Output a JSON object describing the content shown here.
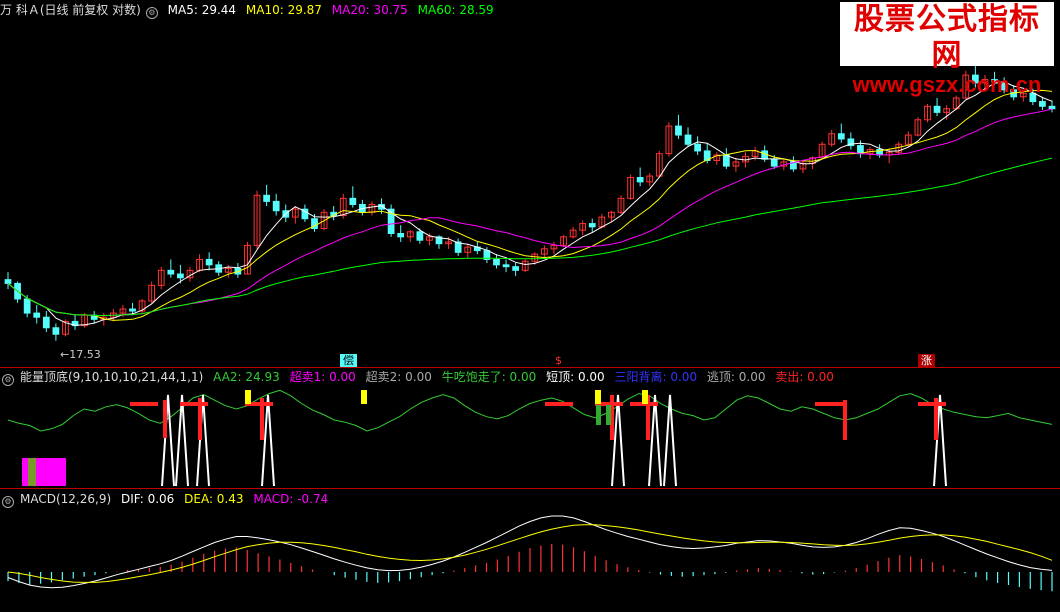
{
  "header": {
    "stock_title": "万 科Ａ(日线 前复权 对数)",
    "ma5": "MA5: 29.44",
    "ma10": "MA10: 29.87",
    "ma20": "MA20: 30.75",
    "ma60": "MA60: 28.59"
  },
  "watermark": {
    "line1": "股票公式指标网",
    "line2": "www.gszx.com.cn"
  },
  "price_panel": {
    "low_label": "17.53",
    "tag1": "偿",
    "tag2": "$",
    "tag3": "涨"
  },
  "indicator_panel": {
    "name": "能量顶底(9,10,10,10,21,44,1,1)",
    "aa2": "AA2: 24.93",
    "chaomai1": "超卖1: 0.00",
    "chaomai2": "超卖2: 0.00",
    "niuchi": "牛吃饱走了: 0.00",
    "duanding": "短顶: 0.00",
    "sanyang": "三阳背离: 0.00",
    "taoding": "逃顶: 0.00",
    "maichu": "卖出: 0.00"
  },
  "macd_panel": {
    "name": "MACD(12,26,9)",
    "dif": "DIF: 0.06",
    "dea": "DEA: 0.43",
    "macd": "MACD: -0.74"
  },
  "colors": {
    "up": "#ff3333",
    "down": "#54fcfc",
    "ma5": "#ffffff",
    "ma10": "#ffff00",
    "ma20": "#ff00ff",
    "ma60": "#00ff00",
    "aa2": "#33cc33",
    "signal_white": "#ffffff",
    "signal_yellow": "#ffff00",
    "signal_red": "#ff2222",
    "dif": "#ffffff",
    "dea": "#ffff00",
    "macd_pos": "#ff3333",
    "macd_neg": "#54fcfc",
    "text_magenta": "#ff00ff"
  },
  "chart_data": {
    "type": "candlestick",
    "scale": "log",
    "ylim": [
      17.0,
      36.0
    ],
    "low_marker": 17.53,
    "last": {
      "ma5": 29.44,
      "ma10": 29.87,
      "ma20": 30.75,
      "ma60": 28.59
    },
    "ohlc": [
      [
        20.5,
        20.9,
        20.0,
        20.3
      ],
      [
        20.3,
        20.4,
        19.3,
        19.5
      ],
      [
        19.5,
        19.7,
        18.6,
        18.8
      ],
      [
        18.8,
        19.2,
        18.3,
        18.6
      ],
      [
        18.6,
        18.9,
        17.9,
        18.1
      ],
      [
        18.1,
        18.3,
        17.5,
        17.8
      ],
      [
        17.8,
        18.5,
        17.7,
        18.4
      ],
      [
        18.4,
        18.7,
        18.0,
        18.2
      ],
      [
        18.2,
        18.8,
        18.1,
        18.7
      ],
      [
        18.7,
        18.9,
        18.3,
        18.5
      ],
      [
        18.5,
        18.8,
        18.2,
        18.6
      ],
      [
        18.6,
        19.0,
        18.4,
        18.8
      ],
      [
        18.8,
        19.2,
        18.6,
        19.0
      ],
      [
        19.0,
        19.3,
        18.7,
        18.9
      ],
      [
        18.9,
        19.5,
        18.8,
        19.4
      ],
      [
        19.4,
        20.4,
        19.3,
        20.2
      ],
      [
        20.2,
        21.2,
        20.0,
        21.0
      ],
      [
        21.0,
        21.6,
        20.6,
        20.8
      ],
      [
        20.8,
        21.3,
        20.3,
        20.6
      ],
      [
        20.6,
        21.2,
        20.4,
        21.0
      ],
      [
        21.0,
        21.9,
        20.9,
        21.6
      ],
      [
        21.6,
        22.0,
        21.0,
        21.3
      ],
      [
        21.3,
        21.5,
        20.7,
        20.9
      ],
      [
        20.9,
        21.3,
        20.6,
        21.1
      ],
      [
        21.1,
        21.4,
        20.6,
        20.8
      ],
      [
        20.8,
        22.6,
        20.8,
        22.4
      ],
      [
        22.4,
        25.8,
        22.2,
        25.5
      ],
      [
        25.5,
        26.2,
        24.8,
        25.1
      ],
      [
        25.1,
        25.6,
        24.2,
        24.5
      ],
      [
        24.5,
        24.9,
        23.8,
        24.1
      ],
      [
        24.1,
        24.8,
        23.7,
        24.6
      ],
      [
        24.6,
        24.9,
        23.8,
        24.0
      ],
      [
        24.0,
        24.3,
        23.2,
        23.4
      ],
      [
        23.4,
        24.6,
        23.3,
        24.4
      ],
      [
        24.4,
        24.8,
        23.9,
        24.2
      ],
      [
        24.2,
        25.6,
        24.0,
        25.3
      ],
      [
        25.3,
        26.1,
        24.7,
        24.9
      ],
      [
        24.9,
        25.2,
        24.2,
        24.4
      ],
      [
        24.4,
        25.1,
        24.2,
        24.9
      ],
      [
        24.9,
        25.3,
        24.3,
        24.6
      ],
      [
        24.6,
        24.9,
        22.9,
        23.1
      ],
      [
        23.1,
        23.6,
        22.6,
        22.9
      ],
      [
        22.9,
        23.3,
        22.6,
        23.2
      ],
      [
        23.2,
        23.4,
        22.5,
        22.7
      ],
      [
        22.7,
        23.1,
        22.4,
        22.9
      ],
      [
        22.9,
        23.0,
        22.2,
        22.5
      ],
      [
        22.5,
        22.9,
        22.2,
        22.6
      ],
      [
        22.6,
        22.8,
        21.8,
        22.0
      ],
      [
        22.0,
        22.5,
        21.7,
        22.3
      ],
      [
        22.3,
        22.6,
        21.9,
        22.1
      ],
      [
        22.1,
        22.3,
        21.4,
        21.6
      ],
      [
        21.6,
        21.9,
        21.1,
        21.3
      ],
      [
        21.3,
        21.6,
        20.9,
        21.2
      ],
      [
        21.2,
        21.4,
        20.7,
        21.0
      ],
      [
        21.0,
        21.6,
        20.9,
        21.5
      ],
      [
        21.5,
        22.0,
        21.3,
        21.9
      ],
      [
        21.9,
        22.4,
        21.7,
        22.2
      ],
      [
        22.2,
        22.6,
        21.9,
        22.4
      ],
      [
        22.4,
        23.0,
        22.3,
        22.9
      ],
      [
        22.9,
        23.5,
        22.8,
        23.3
      ],
      [
        23.3,
        23.9,
        23.0,
        23.7
      ],
      [
        23.7,
        24.0,
        23.2,
        23.5
      ],
      [
        23.5,
        24.3,
        23.4,
        24.1
      ],
      [
        24.1,
        24.5,
        23.8,
        24.4
      ],
      [
        24.4,
        25.5,
        24.3,
        25.3
      ],
      [
        25.3,
        26.9,
        25.2,
        26.7
      ],
      [
        26.7,
        27.4,
        26.1,
        26.4
      ],
      [
        26.4,
        27.0,
        26.1,
        26.8
      ],
      [
        26.8,
        28.6,
        26.7,
        28.4
      ],
      [
        28.4,
        30.8,
        28.2,
        30.5
      ],
      [
        30.5,
        31.4,
        29.5,
        29.8
      ],
      [
        29.8,
        30.4,
        28.9,
        29.1
      ],
      [
        29.1,
        29.7,
        28.3,
        28.6
      ],
      [
        28.6,
        29.2,
        27.7,
        27.9
      ],
      [
        27.9,
        28.5,
        27.6,
        28.3
      ],
      [
        28.3,
        28.8,
        27.3,
        27.5
      ],
      [
        27.5,
        28.1,
        27.1,
        27.8
      ],
      [
        27.8,
        28.5,
        27.4,
        28.2
      ],
      [
        28.2,
        28.9,
        27.9,
        28.6
      ],
      [
        28.6,
        29.0,
        27.8,
        28.0
      ],
      [
        28.0,
        28.3,
        27.3,
        27.5
      ],
      [
        27.5,
        28.0,
        27.2,
        27.8
      ],
      [
        27.8,
        28.2,
        27.1,
        27.3
      ],
      [
        27.3,
        27.9,
        27.0,
        27.7
      ],
      [
        27.7,
        28.2,
        27.3,
        28.1
      ],
      [
        28.1,
        29.3,
        28.0,
        29.1
      ],
      [
        29.1,
        30.2,
        28.9,
        29.9
      ],
      [
        29.9,
        30.7,
        29.2,
        29.5
      ],
      [
        29.5,
        30.0,
        28.7,
        29.0
      ],
      [
        29.0,
        29.4,
        28.1,
        28.4
      ],
      [
        28.4,
        28.9,
        28.0,
        28.7
      ],
      [
        28.7,
        29.1,
        28.1,
        28.3
      ],
      [
        28.3,
        28.8,
        27.7,
        28.5
      ],
      [
        28.5,
        29.3,
        28.3,
        29.1
      ],
      [
        29.1,
        30.1,
        28.9,
        29.8
      ],
      [
        29.8,
        31.2,
        29.7,
        31.0
      ],
      [
        31.0,
        32.3,
        30.8,
        32.1
      ],
      [
        32.1,
        32.8,
        31.3,
        31.6
      ],
      [
        31.6,
        32.2,
        31.0,
        31.9
      ],
      [
        31.9,
        33.0,
        31.8,
        32.8
      ],
      [
        32.8,
        35.2,
        32.7,
        34.8
      ],
      [
        34.8,
        35.7,
        33.7,
        34.1
      ],
      [
        34.1,
        34.8,
        33.6,
        34.4
      ],
      [
        34.4,
        35.1,
        33.9,
        34.2
      ],
      [
        34.2,
        34.6,
        33.2,
        33.5
      ],
      [
        33.5,
        33.9,
        32.6,
        32.9
      ],
      [
        32.9,
        33.5,
        32.5,
        33.2
      ],
      [
        33.2,
        33.6,
        32.2,
        32.5
      ],
      [
        32.5,
        32.9,
        31.8,
        32.1
      ],
      [
        32.1,
        32.6,
        31.6,
        31.9
      ]
    ],
    "aa2": [
      60,
      57,
      55,
      50,
      52,
      56,
      64,
      70,
      68,
      72,
      74,
      71,
      66,
      60,
      57,
      63,
      71,
      80,
      83,
      78,
      73,
      70,
      73,
      79,
      84,
      87,
      82,
      75,
      69,
      65,
      60,
      58,
      55,
      50,
      53,
      58,
      63,
      70,
      76,
      80,
      83,
      80,
      73,
      67,
      63,
      61,
      64,
      70,
      75,
      78,
      80,
      77,
      71,
      65,
      62,
      66,
      72,
      79,
      84,
      82,
      75,
      70,
      66,
      64,
      60,
      62,
      70,
      78,
      82,
      80,
      75,
      70,
      68,
      72,
      70,
      66,
      62,
      60,
      62,
      66,
      70,
      76,
      82,
      84,
      80,
      74,
      70,
      67,
      65,
      63,
      62,
      64,
      66,
      62,
      60,
      58,
      56
    ],
    "macd_hist": [
      -0.35,
      -0.42,
      -0.5,
      -0.45,
      -0.4,
      -0.32,
      -0.25,
      -0.18,
      -0.12,
      -0.05,
      0.02,
      0.08,
      0.12,
      0.16,
      0.2,
      0.28,
      0.4,
      0.55,
      0.7,
      0.82,
      0.9,
      0.95,
      0.85,
      0.72,
      0.6,
      0.48,
      0.35,
      0.22,
      0.1,
      0.0,
      -0.12,
      -0.22,
      -0.3,
      -0.38,
      -0.42,
      -0.4,
      -0.35,
      -0.28,
      -0.2,
      -0.12,
      -0.05,
      0.05,
      0.15,
      0.25,
      0.35,
      0.48,
      0.62,
      0.78,
      0.92,
      1.02,
      1.08,
      1.05,
      0.95,
      0.8,
      0.62,
      0.45,
      0.3,
      0.18,
      0.08,
      -0.02,
      -0.1,
      -0.15,
      -0.18,
      -0.16,
      -0.12,
      -0.08,
      -0.03,
      0.05,
      0.1,
      0.15,
      0.12,
      0.08,
      0.02,
      -0.05,
      -0.1,
      -0.08,
      -0.02,
      0.05,
      0.15,
      0.28,
      0.42,
      0.55,
      0.65,
      0.6,
      0.5,
      0.38,
      0.25,
      0.1,
      -0.05,
      -0.2,
      -0.32,
      -0.42,
      -0.5,
      -0.58,
      -0.65,
      -0.7,
      -0.74
    ],
    "dif": [
      -0.2,
      -0.35,
      -0.48,
      -0.55,
      -0.58,
      -0.56,
      -0.5,
      -0.42,
      -0.33,
      -0.22,
      -0.1,
      0.0,
      0.1,
      0.2,
      0.3,
      0.42,
      0.58,
      0.75,
      0.92,
      1.08,
      1.2,
      1.3,
      1.3,
      1.25,
      1.18,
      1.1,
      1.0,
      0.88,
      0.75,
      0.62,
      0.48,
      0.36,
      0.25,
      0.15,
      0.08,
      0.05,
      0.06,
      0.1,
      0.18,
      0.28,
      0.4,
      0.55,
      0.72,
      0.9,
      1.08,
      1.28,
      1.48,
      1.68,
      1.85,
      1.98,
      2.05,
      2.05,
      1.98,
      1.85,
      1.7,
      1.55,
      1.42,
      1.3,
      1.2,
      1.1,
      1.0,
      0.93,
      0.88,
      0.86,
      0.88,
      0.92,
      0.97,
      1.05,
      1.1,
      1.15,
      1.14,
      1.1,
      1.05,
      0.98,
      0.92,
      0.9,
      0.92,
      0.98,
      1.08,
      1.22,
      1.38,
      1.52,
      1.62,
      1.6,
      1.52,
      1.42,
      1.3,
      1.15,
      0.98,
      0.82,
      0.66,
      0.52,
      0.38,
      0.26,
      0.16,
      0.1,
      0.06
    ],
    "dea": [
      0.0,
      -0.05,
      -0.12,
      -0.2,
      -0.27,
      -0.33,
      -0.37,
      -0.38,
      -0.38,
      -0.35,
      -0.3,
      -0.24,
      -0.17,
      -0.1,
      -0.02,
      0.07,
      0.17,
      0.29,
      0.42,
      0.56,
      0.69,
      0.82,
      0.93,
      1.0,
      1.06,
      1.09,
      1.09,
      1.07,
      1.03,
      0.97,
      0.9,
      0.82,
      0.74,
      0.65,
      0.57,
      0.51,
      0.46,
      0.43,
      0.42,
      0.44,
      0.48,
      0.54,
      0.62,
      0.72,
      0.83,
      0.96,
      1.09,
      1.22,
      1.35,
      1.47,
      1.57,
      1.65,
      1.71,
      1.73,
      1.73,
      1.7,
      1.66,
      1.6,
      1.54,
      1.46,
      1.39,
      1.32,
      1.25,
      1.19,
      1.14,
      1.1,
      1.08,
      1.07,
      1.07,
      1.08,
      1.09,
      1.09,
      1.08,
      1.06,
      1.03,
      1.0,
      0.98,
      0.97,
      0.99,
      1.03,
      1.09,
      1.16,
      1.24,
      1.3,
      1.34,
      1.36,
      1.36,
      1.33,
      1.28,
      1.2,
      1.12,
      1.02,
      0.92,
      0.82,
      0.71,
      0.58,
      0.43
    ]
  }
}
